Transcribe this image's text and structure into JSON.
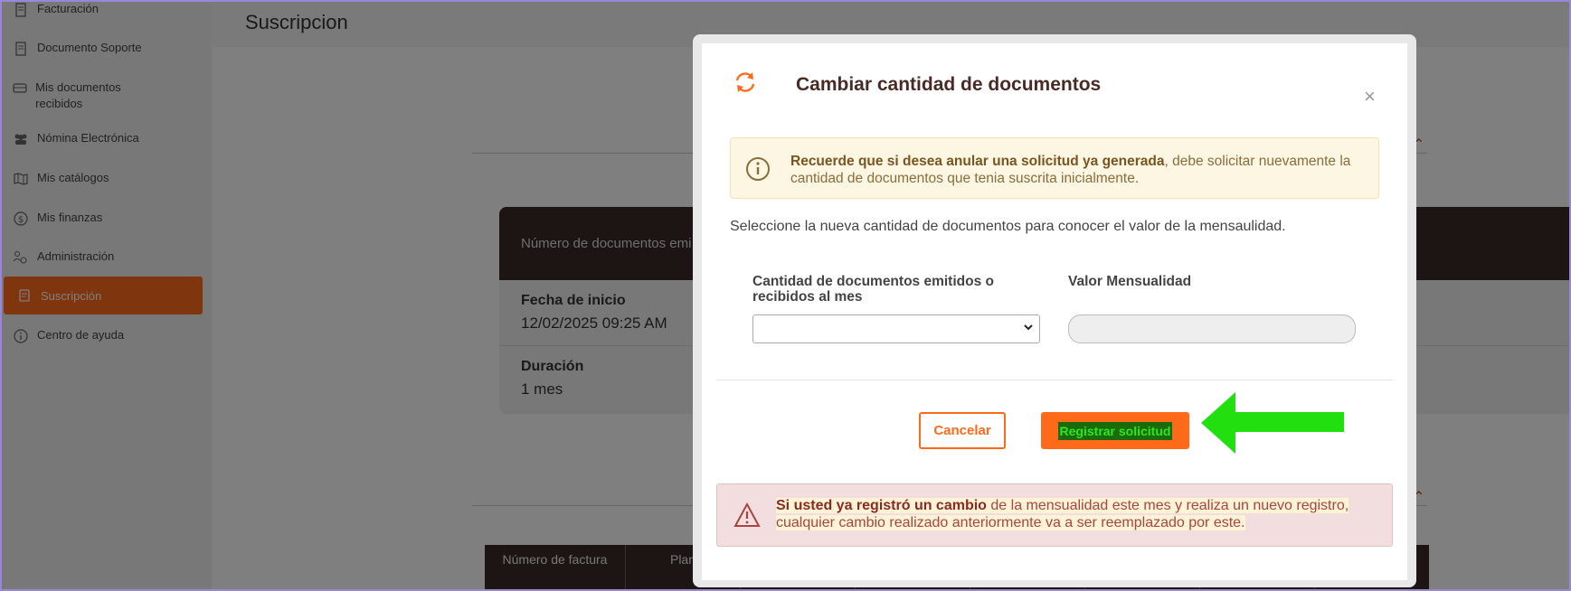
{
  "sidebar": {
    "items": [
      {
        "label": "Facturación",
        "icon": "invoice-icon"
      },
      {
        "label": "Documento Soporte",
        "icon": "document-icon"
      },
      {
        "label": "Mis documentos recibidos",
        "icon": "inbox-icon"
      },
      {
        "label": "Nómina Electrónica",
        "icon": "users-icon"
      },
      {
        "label": "Mis catálogos",
        "icon": "map-icon"
      },
      {
        "label": "Mis finanzas",
        "icon": "dollar-icon"
      },
      {
        "label": "Administración",
        "icon": "admin-icon"
      },
      {
        "label": "Suscripción",
        "icon": "subscription-icon",
        "active": true
      },
      {
        "label": "Centro de ayuda",
        "icon": "info-icon"
      }
    ]
  },
  "page": {
    "title": "Suscripcion"
  },
  "background_card": {
    "header": "Número de documentos emi",
    "rows": [
      {
        "label": "Fecha de inicio",
        "value": "12/02/2025 09:25 AM"
      },
      {
        "label": "Duración",
        "value": "1 mes"
      }
    ]
  },
  "background_table": {
    "columns": [
      "Número de factura",
      "Plan",
      "",
      "",
      "",
      "",
      "",
      ""
    ]
  },
  "modal": {
    "title": "Cambiar cantidad de documentos",
    "close_label": "×",
    "info": {
      "bold": "Recuerde que si desea anular una solicitud ya generada",
      "rest": ", debe solicitar nuevamente la cantidad de documentos que tenia suscrita inicialmente."
    },
    "instruction": "Seleccione la nueva cantidad de documentos para conocer el valor de la mensaulidad.",
    "quantity_label": "Cantidad de documentos emitidos o recibidos al mes",
    "quantity_value": "",
    "monthly_label": "Valor Mensualidad",
    "monthly_value": "",
    "cancel_label": "Cancelar",
    "register_label": "Registrar solicitud",
    "warning": {
      "bold": "Si usted ya registró un cambio",
      "rest": " de la mensualidad este mes y realiza un nuevo registro, cualquier cambio realizado anteriormente va a ser reemplazado por este."
    }
  },
  "colors": {
    "accent": "#ff6a1a",
    "annotation_arrow": "#22e010"
  }
}
